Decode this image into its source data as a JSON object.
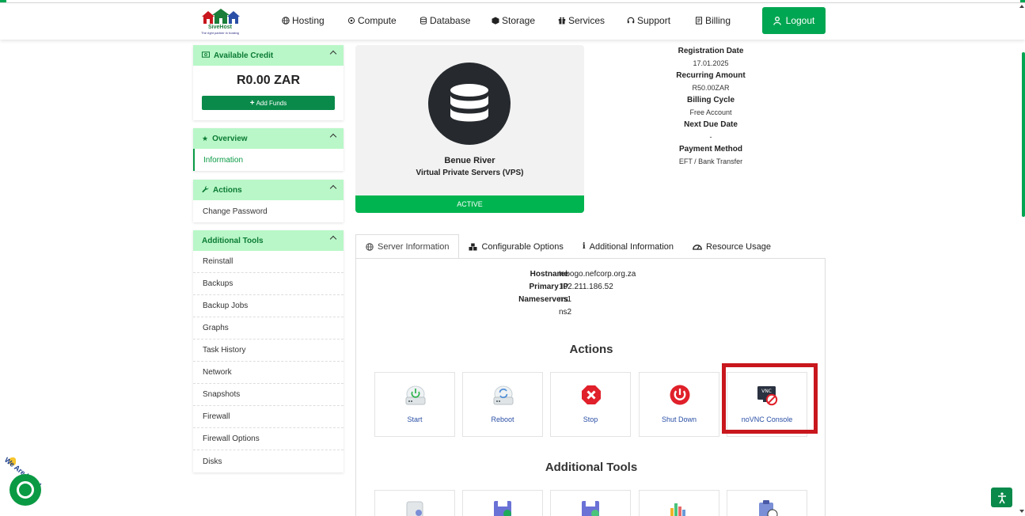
{
  "brand": {
    "name": "SiveHost",
    "tagline": "The right partner in hosting"
  },
  "nav": {
    "items": [
      {
        "label": "Hosting",
        "icon": "globe-icon"
      },
      {
        "label": "Compute",
        "icon": "cpu-icon"
      },
      {
        "label": "Database",
        "icon": "database-icon"
      },
      {
        "label": "Storage",
        "icon": "box-icon"
      },
      {
        "label": "Services",
        "icon": "gift-icon"
      },
      {
        "label": "Support",
        "icon": "headset-icon"
      },
      {
        "label": "Billing",
        "icon": "invoice-icon"
      }
    ],
    "logout_label": "Logout"
  },
  "sidebar": {
    "credit": {
      "title": "Available Credit",
      "amount": "R0.00 ZAR",
      "add_funds": "Add Funds"
    },
    "overview": {
      "title": "Overview",
      "items": [
        "Information"
      ]
    },
    "actions": {
      "title": "Actions",
      "items": [
        "Change Password"
      ]
    },
    "tools": {
      "title": "Additional Tools",
      "items": [
        "Reinstall",
        "Backups",
        "Backup Jobs",
        "Graphs",
        "Task History",
        "Network",
        "Snapshots",
        "Firewall",
        "Firewall Options",
        "Disks"
      ]
    }
  },
  "product": {
    "name": "Benue River",
    "group": "Virtual Private Servers (VPS)",
    "status": "ACTIVE"
  },
  "billing": {
    "registration_label": "Registration Date",
    "registration_value": "17.01.2025",
    "recurring_label": "Recurring Amount",
    "recurring_value": "R50.00ZAR",
    "cycle_label": "Billing Cycle",
    "cycle_value": "Free Account",
    "due_label": "Next Due Date",
    "due_value": "-",
    "payment_label": "Payment Method",
    "payment_value": "EFT / Bank Transfer"
  },
  "tabs": [
    "Server Information",
    "Configurable Options",
    "Additional Information",
    "Resource Usage"
  ],
  "server": {
    "hostname_label": "Hostname",
    "hostname": "tebogo.nefcorp.org.za",
    "ip_label": "Primary IP",
    "ip": "102.211.186.52",
    "ns_label": "Nameservers",
    "ns1": "ns1",
    "ns2": "ns2"
  },
  "actions_title": "Actions",
  "actions": [
    "Start",
    "Reboot",
    "Stop",
    "Shut Down",
    "noVNC Console"
  ],
  "vnc_badge": "VNC",
  "tools_title": "Additional Tools",
  "chat": {
    "tag": "We Are Here!"
  },
  "colors": {
    "accent": "#00a651",
    "panel_header": "#b9f7c8",
    "highlight": "#c8171d",
    "link": "#2a4fa6"
  }
}
